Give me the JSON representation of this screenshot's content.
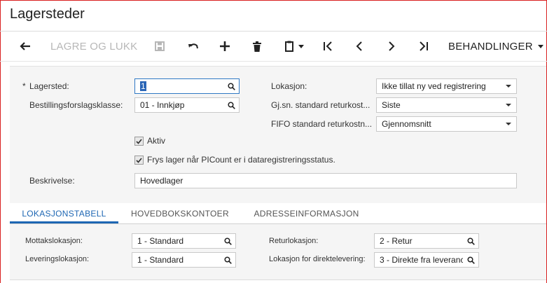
{
  "header": {
    "title": "Lagersteder"
  },
  "toolbar": {
    "save_close_label": "LAGRE OG LUKK",
    "actions_label": "BEHANDLINGER",
    "icons": [
      "back-arrow-icon",
      "save-icon",
      "undo-icon",
      "plus-icon",
      "trash-icon",
      "clipboard-icon",
      "first-record-icon",
      "previous-record-icon",
      "next-record-icon",
      "last-record-icon"
    ]
  },
  "form": {
    "required_mark": "*",
    "lagersted": {
      "label": "Lagersted:",
      "value": "1"
    },
    "bestillingsforslagsklasse": {
      "label": "Bestillingsforslagsklasse:",
      "value": "01 - Innkjøp"
    },
    "lokasjon": {
      "label": "Lokasjon:",
      "value": "Ikke tillat ny ved registrering"
    },
    "gjsn_standard": {
      "label": "Gj.sn. standard returkost...",
      "value": "Siste"
    },
    "fifo_standard": {
      "label": "FIFO standard returkostn...",
      "value": "Gjennomsnitt"
    },
    "aktiv": {
      "label": "Aktiv",
      "checked": true
    },
    "frys_lager": {
      "label": "Frys lager når PICount er i dataregistreringsstatus.",
      "checked": true
    },
    "beskrivelse": {
      "label": "Beskrivelse:",
      "value": "Hovedlager"
    }
  },
  "tabs": [
    {
      "label": "LOKASJONSTABELL",
      "active": true
    },
    {
      "label": "HOVEDBOKSKONTOER",
      "active": false
    },
    {
      "label": "ADRESSEINFORMASJON",
      "active": false
    }
  ],
  "locations": {
    "mottak": {
      "label": "Mottakslokasjon:",
      "value": "1 - Standard"
    },
    "levering": {
      "label": "Leveringslokasjon:",
      "value": "1 - Standard"
    },
    "retur": {
      "label": "Returlokasjon:",
      "value": "2 - Retur"
    },
    "direkte": {
      "label": "Lokasjon for direktelevering:",
      "value": "3 - Direkte fra leveranc"
    }
  },
  "colors": {
    "accent": "#1d66b3",
    "border": "#d92020",
    "selection": "#2a65b6"
  }
}
